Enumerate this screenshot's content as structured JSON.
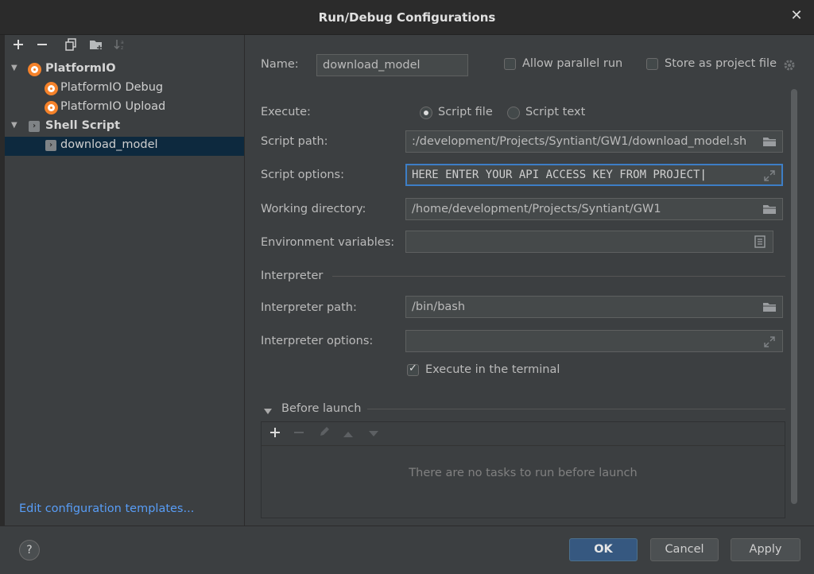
{
  "window": {
    "title": "Run/Debug Configurations"
  },
  "icons": {
    "add": "plus-icon",
    "remove": "minus-icon",
    "copy": "copy-icon",
    "folder": "new-folder-icon",
    "sort": "sort-icon",
    "platformio": "platformio-icon",
    "shell": "shell-script-icon",
    "browse": "folder-icon",
    "expand": "expand-icon",
    "env": "document-icon",
    "settings": "gear-icon",
    "edit": "pencil-icon",
    "up": "arrow-up-icon",
    "down": "arrow-down-icon"
  },
  "tree": {
    "group1": "PlatformIO",
    "g1_item1": "PlatformIO Debug",
    "g1_item2": "PlatformIO Upload",
    "group2": "Shell Script",
    "g2_item1": "download_model"
  },
  "sidebar": {
    "edit_templates": "Edit configuration templates..."
  },
  "form": {
    "name_label": "Name:",
    "name_value": "download_model",
    "allow_parallel": "Allow parallel run",
    "store_project": "Store as project file",
    "execute_label": "Execute:",
    "script_file": "Script file",
    "script_text": "Script text",
    "script_path_label": "Script path:",
    "script_path_value": ":/development/Projects/Syntiant/GW1/download_model.sh",
    "script_options_label": "Script options:",
    "script_options_value": "HERE ENTER YOUR API ACCESS KEY FROM PROJECT",
    "working_dir_label": "Working directory:",
    "working_dir_value": "/home/development/Projects/Syntiant/GW1",
    "env_label": "Environment variables:",
    "env_value": "",
    "interpreter_section": "Interpreter",
    "interp_path_label": "Interpreter path:",
    "interp_path_value": "/bin/bash",
    "interp_options_label": "Interpreter options:",
    "interp_options_value": "",
    "execute_terminal": "Execute in the terminal"
  },
  "before_launch": {
    "title": "Before launch",
    "empty": "There are no tasks to run before launch"
  },
  "footer": {
    "help": "?",
    "ok": "OK",
    "cancel": "Cancel",
    "apply": "Apply"
  }
}
